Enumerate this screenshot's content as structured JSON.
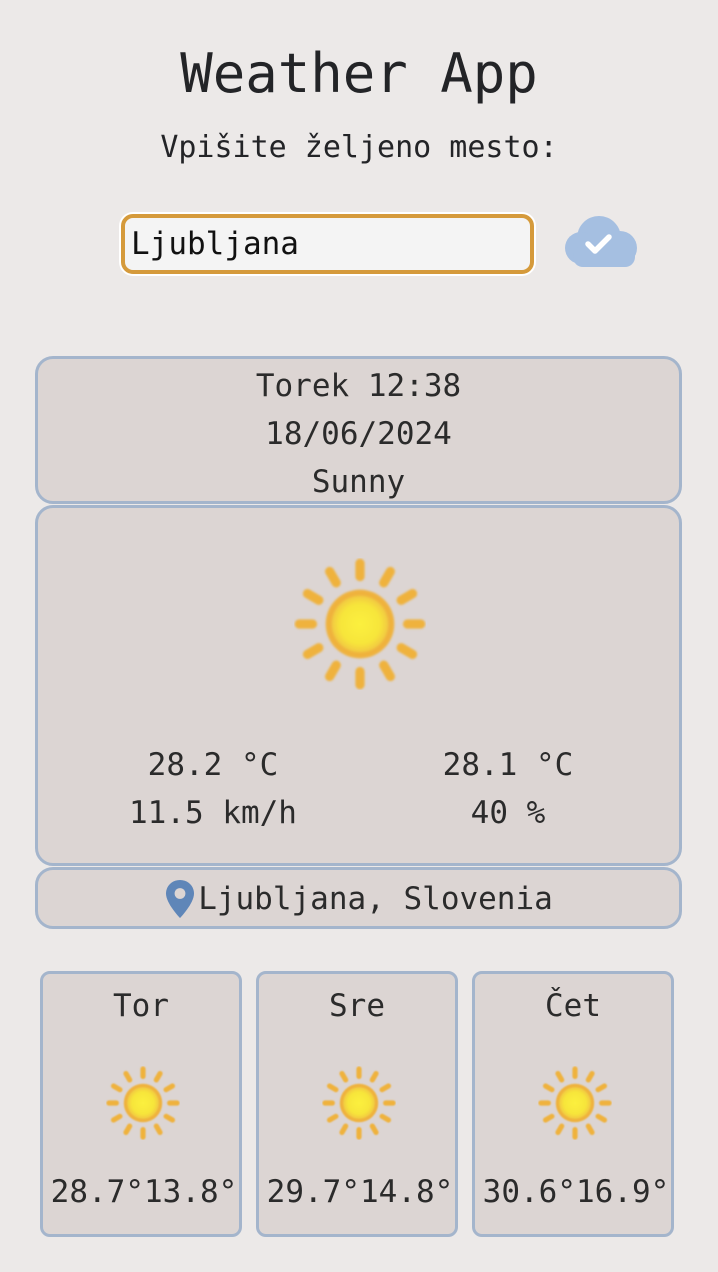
{
  "header": {
    "title": "Weather App",
    "subtitle": "Vpišite željeno mesto:"
  },
  "search": {
    "value": "Ljubljana",
    "submit_icon": "cloud-check-icon"
  },
  "current": {
    "day_time": "Torek 12:38",
    "date": "18/06/2024",
    "condition": "Sunny",
    "condition_icon": "sun-icon",
    "temperature": "28.2 °C",
    "feels_like": "28.1 °C",
    "wind": "11.5 km/h",
    "humidity": "40 %"
  },
  "location": {
    "icon": "map-pin-icon",
    "text": "Ljubljana, Slovenia"
  },
  "forecast": [
    {
      "day": "Tor",
      "icon": "sun-icon",
      "temps": "28.7°13.8°"
    },
    {
      "day": "Sre",
      "icon": "sun-icon",
      "temps": "29.7°14.8°"
    },
    {
      "day": "Čet",
      "icon": "sun-icon",
      "temps": "30.6°16.9°"
    }
  ],
  "colors": {
    "background": "#ece9e8",
    "card": "#dcd5d3",
    "card_border": "#a4b5cc",
    "input_border": "#d59a3b",
    "accent_blue": "#5f86b8",
    "sun_core": "#f7e53a",
    "sun_ray": "#efb23d"
  }
}
